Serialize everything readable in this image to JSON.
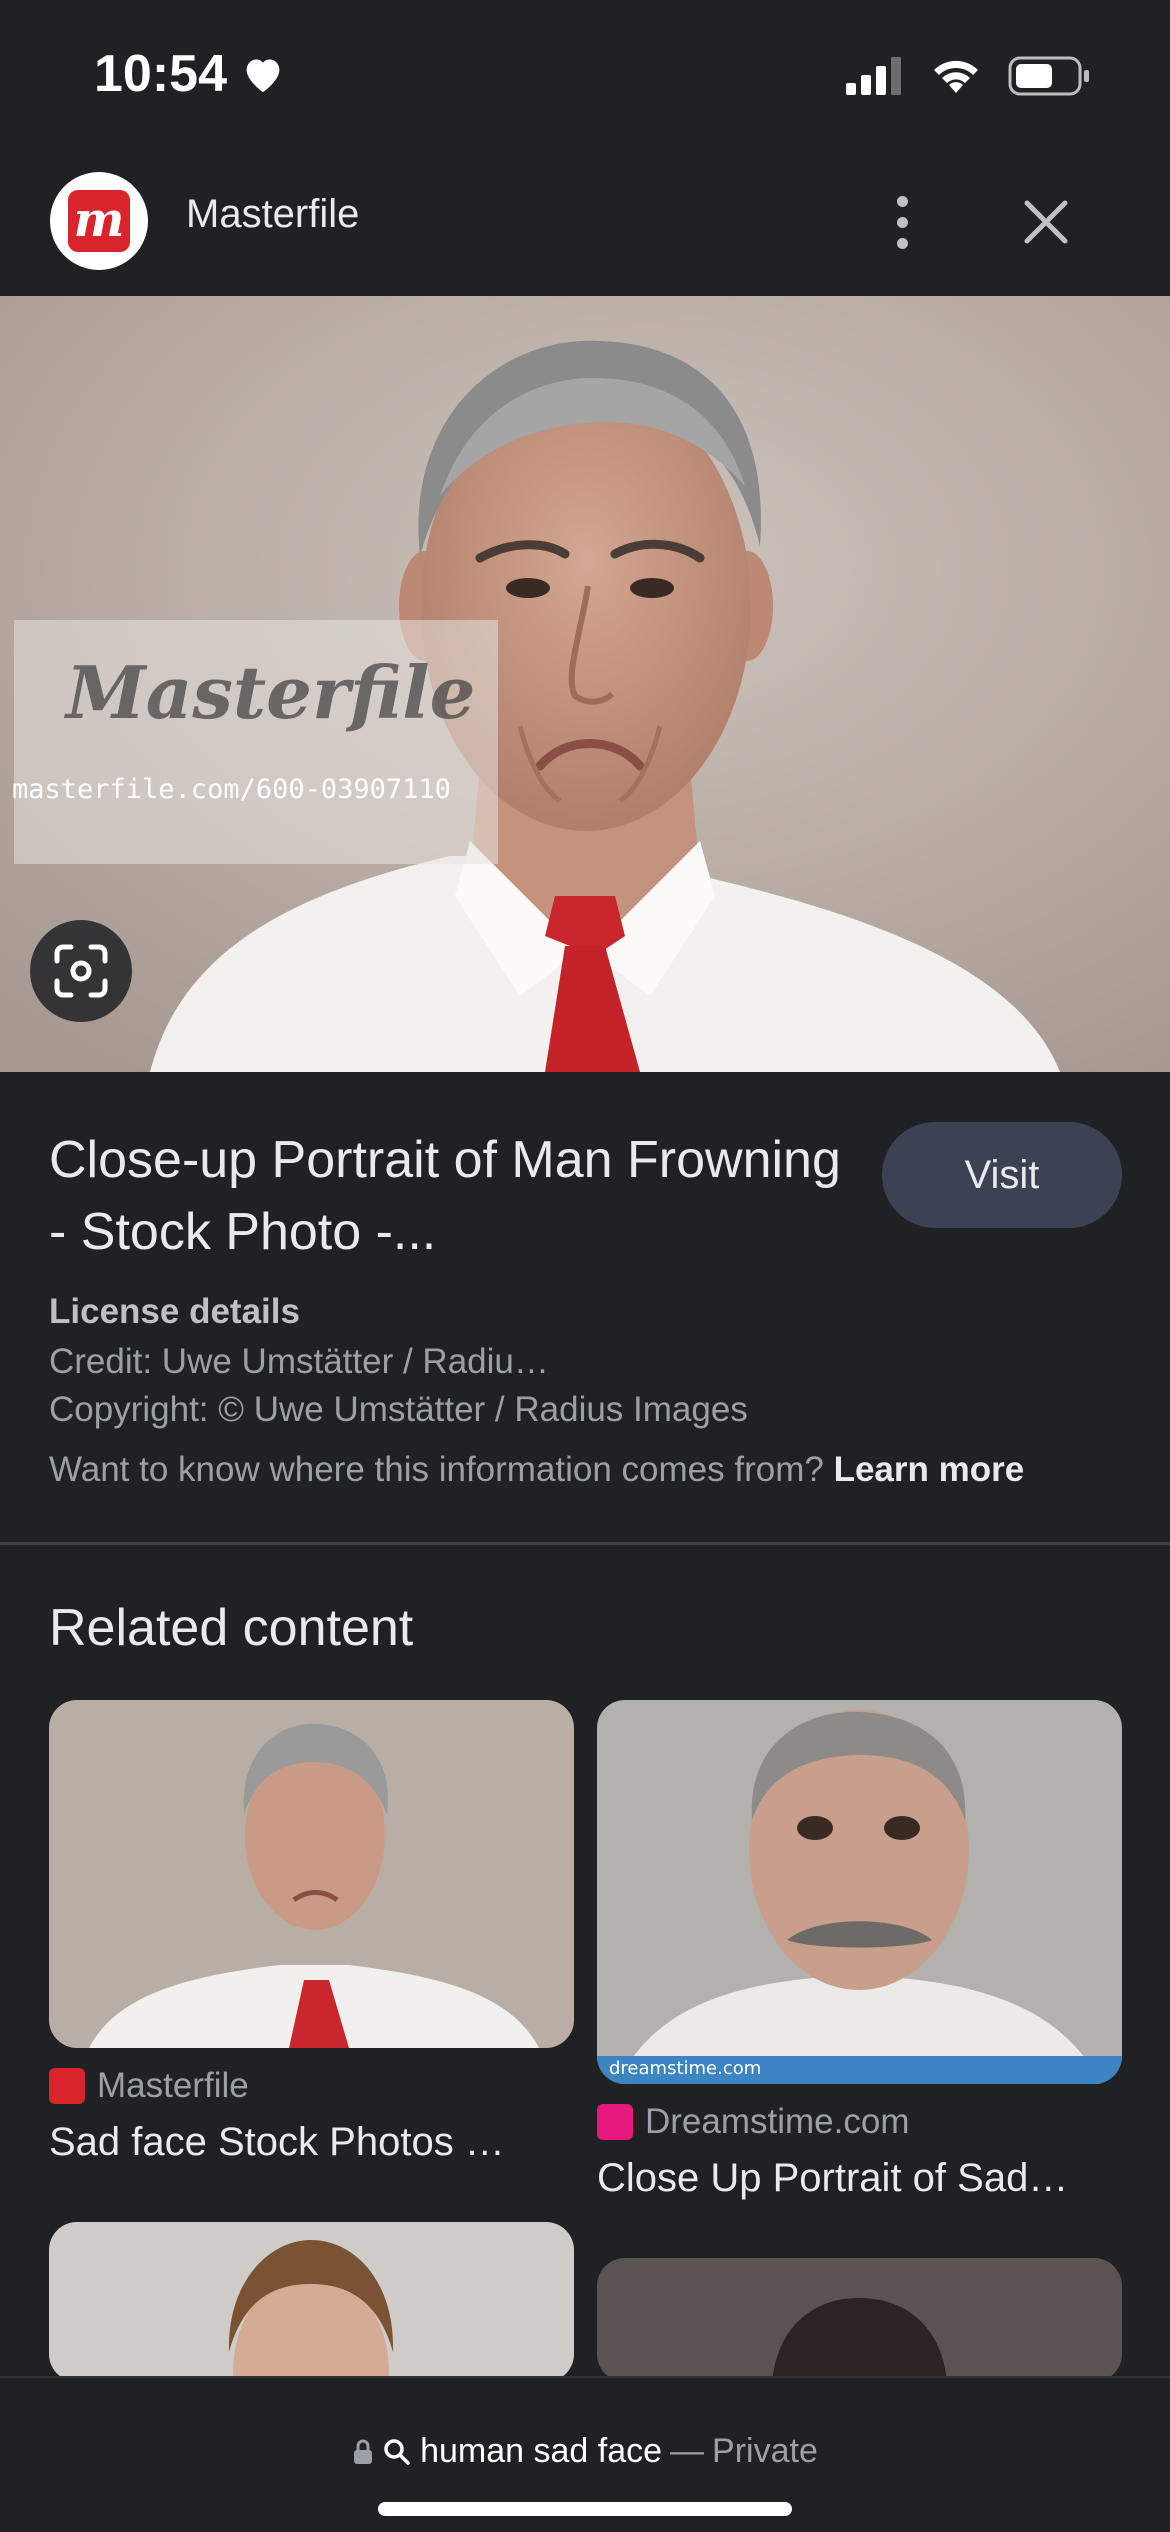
{
  "status": {
    "time": "10:54"
  },
  "header": {
    "site_name": "Masterfile",
    "logo_letter": "m"
  },
  "hero": {
    "watermark_brand": "Masterfile",
    "watermark_url": "masterfile.com/600-03907110"
  },
  "result": {
    "title": "Close-up Portrait of Man Frowning - Stock Photo -...",
    "visit_label": "Visit",
    "license_heading": "License details",
    "credit": "Credit: Uwe Umstätter / Radiu…",
    "copyright": "Copyright: © Uwe Umstätter / Radius Images",
    "info_question": "Want to know where this information comes from?",
    "learn_more": "Learn more"
  },
  "related": {
    "heading": "Related content",
    "items": [
      {
        "source": "Masterfile",
        "title": "Sad face Stock Photos …"
      },
      {
        "source": "Dreamstime.com",
        "title": "Close Up Portrait of Sad…",
        "watermark": "dreamstime.com"
      }
    ]
  },
  "bottom_bar": {
    "query": "human sad face",
    "separator": "—",
    "mode": "Private"
  },
  "colors": {
    "background": "#202124",
    "visit_button": "#3c4254",
    "masterfile_red": "#d9242b",
    "dreamstime_pink": "#e8197e",
    "tie_red": "#c9272d"
  }
}
